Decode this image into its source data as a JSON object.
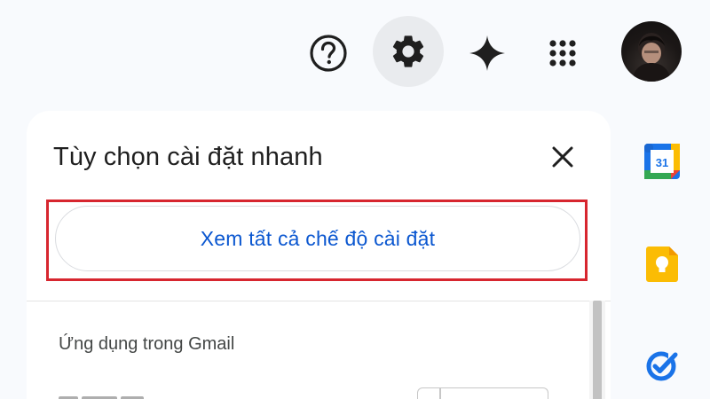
{
  "header": {
    "help_icon": "help-circle-icon",
    "settings_icon": "gear-icon",
    "gemini_icon": "sparkle-icon",
    "apps_icon": "apps-grid-icon"
  },
  "quick_settings": {
    "title": "Tùy chọn cài đặt nhanh",
    "see_all_button": "Xem tất cả chế độ cài đặt",
    "section_title": "Ứng dụng trong Gmail"
  },
  "side_panel": {
    "calendar_label": "31"
  },
  "colors": {
    "accent": "#0b57d0",
    "highlight": "#d7262f",
    "background": "#f8fafd"
  }
}
